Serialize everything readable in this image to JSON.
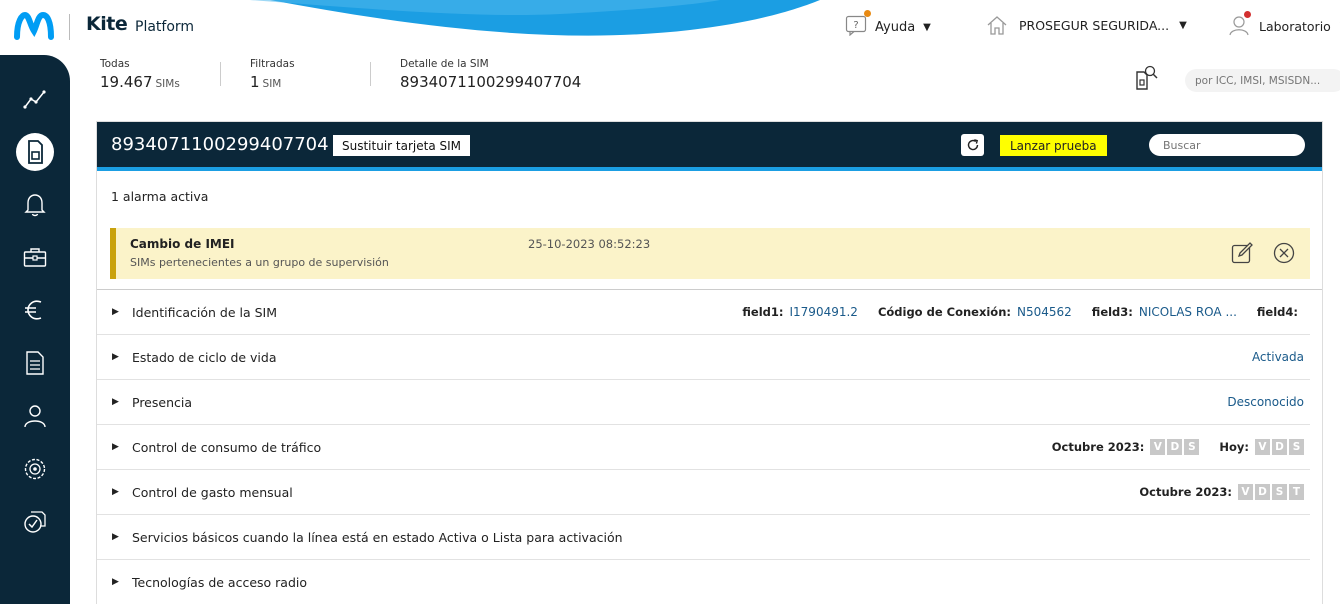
{
  "header": {
    "brand": "Kite",
    "brand_sub": "Platform",
    "help_label": "Ayuda",
    "company_label": "PROSEGUR SEGURIDA...",
    "user_label": "Laboratorio",
    "notification_color": "#e88a13",
    "user_badge_color": "#d32f2f"
  },
  "summary": {
    "all_label": "Todas",
    "all_value": "19.467",
    "all_unit": "SIMs",
    "filtered_label": "Filtradas",
    "filtered_value": "1",
    "filtered_unit": "SIM",
    "detail_label": "Detalle de la SIM",
    "detail_value": "8934071100299407704",
    "search_placeholder": "por ICC, IMSI, MSISDN..."
  },
  "sidebar": {
    "items": [
      {
        "name": "analytics-icon"
      },
      {
        "name": "sim-card-icon",
        "active": true
      },
      {
        "name": "bell-icon"
      },
      {
        "name": "briefcase-icon"
      },
      {
        "name": "euro-icon"
      },
      {
        "name": "document-icon"
      },
      {
        "name": "user-icon"
      },
      {
        "name": "settings-icon"
      },
      {
        "name": "check-shield-icon"
      }
    ]
  },
  "panel": {
    "iccid": "8934071100299407704",
    "replace_sim_label": "Sustituir tarjeta SIM",
    "launch_test_label": "Lanzar prueba",
    "search_placeholder": "Buscar",
    "alarm_count": "1 alarma activa",
    "alarm": {
      "title": "Cambio de IMEI",
      "subtitle": "SIMs pertenecientes a un grupo de supervisión",
      "date": "25-10-2023 08:52:23"
    },
    "rows": [
      {
        "label": "Identificación de la SIM",
        "fields": [
          {
            "key": "field1:",
            "value": "I1790491.2"
          },
          {
            "key": "Código de Conexión:",
            "value": "N504562"
          },
          {
            "key": "field3:",
            "value": "NICOLAS ROA ..."
          },
          {
            "key": "field4:",
            "value": ""
          }
        ]
      },
      {
        "label": "Estado de ciclo de vida",
        "status": "Activada"
      },
      {
        "label": "Presencia",
        "status": "Desconocido"
      },
      {
        "label": "Control de consumo de tráfico",
        "month_label": "Octubre 2023:",
        "month_boxes": [
          "V",
          "D",
          "S"
        ],
        "today_label": "Hoy:",
        "today_boxes": [
          "V",
          "D",
          "S"
        ]
      },
      {
        "label": "Control de gasto mensual",
        "month_label": "Octubre 2023:",
        "month_boxes": [
          "V",
          "D",
          "S",
          "T"
        ]
      },
      {
        "label": "Servicios básicos cuando la línea está en estado Activa o Lista para activación"
      },
      {
        "label": "Tecnologías de acceso radio"
      }
    ]
  }
}
